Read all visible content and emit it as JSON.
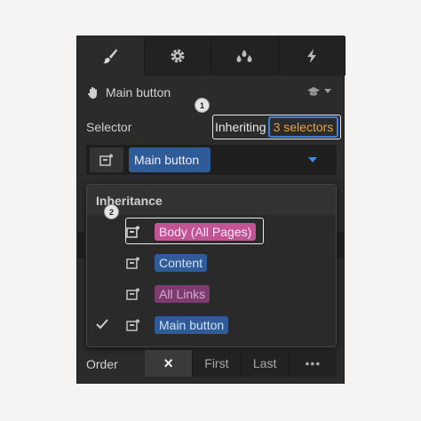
{
  "tabs": [
    {
      "icon": "paintbrush-icon",
      "active": true
    },
    {
      "icon": "gear-icon",
      "active": false
    },
    {
      "icon": "droplets-icon",
      "active": false
    },
    {
      "icon": "lightning-icon",
      "active": false
    }
  ],
  "header": {
    "title": "Main button",
    "hand_icon": "hand-icon",
    "cap_icon": "graduation-cap-icon"
  },
  "badges": {
    "one": "1",
    "two": "2"
  },
  "selector": {
    "label": "Selector",
    "inheriting_text": "Inheriting",
    "count_text": "3 selectors",
    "token": "Main button"
  },
  "inheritance": {
    "title": "Inheritance",
    "items": [
      {
        "label": "Body (All Pages)",
        "color": "#c15493",
        "checked": false,
        "highlighted": true
      },
      {
        "label": "Content",
        "color": "#2f5c99",
        "checked": false,
        "highlighted": false
      },
      {
        "label": "All Links",
        "color": "#7d3c6e",
        "checked": false,
        "highlighted": false
      },
      {
        "label": "Main button",
        "color": "#2f5c99",
        "checked": true,
        "highlighted": false
      }
    ]
  },
  "order": {
    "label": "Order",
    "options": [
      "×",
      "First",
      "Last",
      "•••"
    ],
    "selected": "×"
  },
  "colors": {
    "accent_blue": "#3d7fd6",
    "count_orange": "#e8a33d"
  }
}
